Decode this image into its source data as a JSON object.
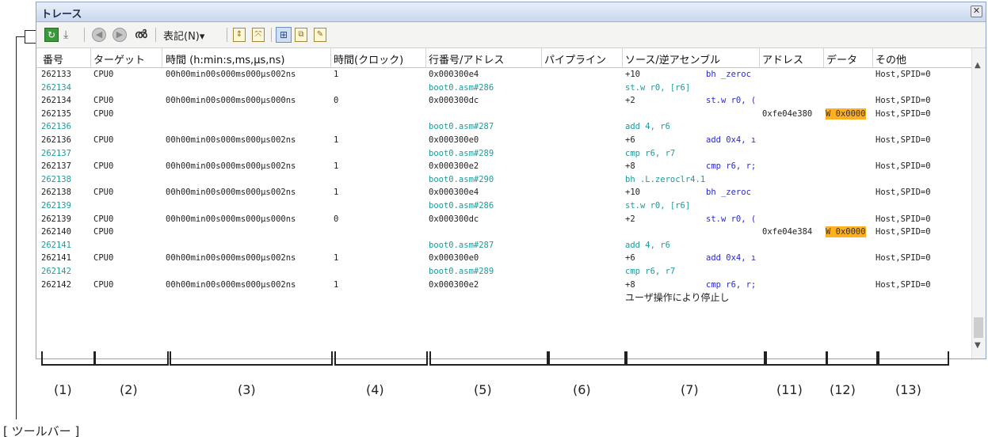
{
  "window": {
    "title": "トレース",
    "close_glyph": "✕"
  },
  "toolbar": {
    "refresh": "↻",
    "filter": "⤓",
    "back": "◀",
    "forward": "▶",
    "find": "ൽ",
    "view_menu": "表記(N)▾",
    "i1": "⇕",
    "i2": "⤧",
    "i3": "⊞",
    "i4": "⧉",
    "i5": "✎"
  },
  "columns": [
    "番号",
    "ターゲット",
    "時間 (h:min:s,ms,μs,ns)",
    "時間(クロック)",
    "行番号/アドレス",
    "パイプライン",
    "ソース/逆アセンブル",
    "アドレス",
    "データ",
    "その他"
  ],
  "rows": [
    {
      "num": "262133",
      "target": "CPU0",
      "time": "00h00min00s000ms000µs002ns",
      "clock": "1",
      "addr": "0x000300e4",
      "src": "+10",
      "asm": "bh _zeroc",
      "radr": "",
      "data": "",
      "other": "Host,SPID=0",
      "type": "exec"
    },
    {
      "num": "262134",
      "target": "",
      "time": "",
      "clock": "",
      "addr": "boot0.asm#286",
      "src": "st.w r0, [r6]",
      "asm": "",
      "radr": "",
      "data": "",
      "other": "",
      "type": "source"
    },
    {
      "num": "262134",
      "target": "CPU0",
      "time": "00h00min00s000ms000µs000ns",
      "clock": "0",
      "addr": "0x000300dc",
      "src": "+2",
      "asm": "st.w r0, (",
      "radr": "",
      "data": "",
      "other": "Host,SPID=0",
      "type": "exec"
    },
    {
      "num": "262135",
      "target": "CPU0",
      "time": "",
      "clock": "",
      "addr": "",
      "src": "",
      "asm": "",
      "radr": "0xfe04e380",
      "data": "W 0x0000",
      "other": "Host,SPID=0",
      "type": "data"
    },
    {
      "num": "262136",
      "target": "",
      "time": "",
      "clock": "",
      "addr": "boot0.asm#287",
      "src": "add 4, r6",
      "asm": "",
      "radr": "",
      "data": "",
      "other": "",
      "type": "source"
    },
    {
      "num": "262136",
      "target": "CPU0",
      "time": "00h00min00s000ms000µs002ns",
      "clock": "1",
      "addr": "0x000300e0",
      "src": "+6",
      "asm": "add 0x4, ı",
      "radr": "",
      "data": "",
      "other": "Host,SPID=0",
      "type": "exec"
    },
    {
      "num": "262137",
      "target": "",
      "time": "",
      "clock": "",
      "addr": "boot0.asm#289",
      "src": "cmp r6, r7",
      "asm": "",
      "radr": "",
      "data": "",
      "other": "",
      "type": "source"
    },
    {
      "num": "262137",
      "target": "CPU0",
      "time": "00h00min00s000ms000µs002ns",
      "clock": "1",
      "addr": "0x000300e2",
      "src": "+8",
      "asm": "cmp r6, r;",
      "radr": "",
      "data": "",
      "other": "Host,SPID=0",
      "type": "exec"
    },
    {
      "num": "262138",
      "target": "",
      "time": "",
      "clock": "",
      "addr": "boot0.asm#290",
      "src": "bh .L.zeroclr4.1",
      "asm": "",
      "radr": "",
      "data": "",
      "other": "",
      "type": "source"
    },
    {
      "num": "262138",
      "target": "CPU0",
      "time": "00h00min00s000ms000µs002ns",
      "clock": "1",
      "addr": "0x000300e4",
      "src": "+10",
      "asm": "bh _zeroc",
      "radr": "",
      "data": "",
      "other": "Host,SPID=0",
      "type": "exec"
    },
    {
      "num": "262139",
      "target": "",
      "time": "",
      "clock": "",
      "addr": "boot0.asm#286",
      "src": "st.w r0, [r6]",
      "asm": "",
      "radr": "",
      "data": "",
      "other": "",
      "type": "source"
    },
    {
      "num": "262139",
      "target": "CPU0",
      "time": "00h00min00s000ms000µs000ns",
      "clock": "0",
      "addr": "0x000300dc",
      "src": "+2",
      "asm": "st.w r0, (",
      "radr": "",
      "data": "",
      "other": "Host,SPID=0",
      "type": "exec"
    },
    {
      "num": "262140",
      "target": "CPU0",
      "time": "",
      "clock": "",
      "addr": "",
      "src": "",
      "asm": "",
      "radr": "0xfe04e384",
      "data": "W 0x0000",
      "other": "Host,SPID=0",
      "type": "data"
    },
    {
      "num": "262141",
      "target": "",
      "time": "",
      "clock": "",
      "addr": "boot0.asm#287",
      "src": "add 4, r6",
      "asm": "",
      "radr": "",
      "data": "",
      "other": "",
      "type": "source"
    },
    {
      "num": "262141",
      "target": "CPU0",
      "time": "00h00min00s000ms000µs002ns",
      "clock": "1",
      "addr": "0x000300e0",
      "src": "+6",
      "asm": "add 0x4, ı",
      "radr": "",
      "data": "",
      "other": "Host,SPID=0",
      "type": "exec"
    },
    {
      "num": "262142",
      "target": "",
      "time": "",
      "clock": "",
      "addr": "boot0.asm#289",
      "src": "cmp r6, r7",
      "asm": "",
      "radr": "",
      "data": "",
      "other": "",
      "type": "source"
    },
    {
      "num": "262142",
      "target": "CPU0",
      "time": "00h00min00s000ms000µs002ns",
      "clock": "1",
      "addr": "0x000300e2",
      "src": "+8",
      "asm": "cmp r6, r;",
      "radr": "",
      "data": "",
      "other": "Host,SPID=0",
      "type": "exec"
    },
    {
      "num": "",
      "target": "",
      "time": "",
      "clock": "",
      "addr": "",
      "src": "ユーザ操作により停止し",
      "asm": "",
      "radr": "",
      "data": "",
      "other": "",
      "type": "status"
    }
  ],
  "scrollbar": {
    "up": "▲",
    "down": "▼"
  },
  "callouts": [
    "(1)",
    "(2)",
    "(3)",
    "(4)",
    "(5)",
    "(6)",
    "(7)",
    "(11)",
    "(12)",
    "(13)"
  ],
  "toolbar_label": "[ ツールバー ]",
  "colors": {
    "source_text": "#1f9a9a",
    "asm_text": "#2a2ad0",
    "data_highlight": "#ffb020"
  }
}
